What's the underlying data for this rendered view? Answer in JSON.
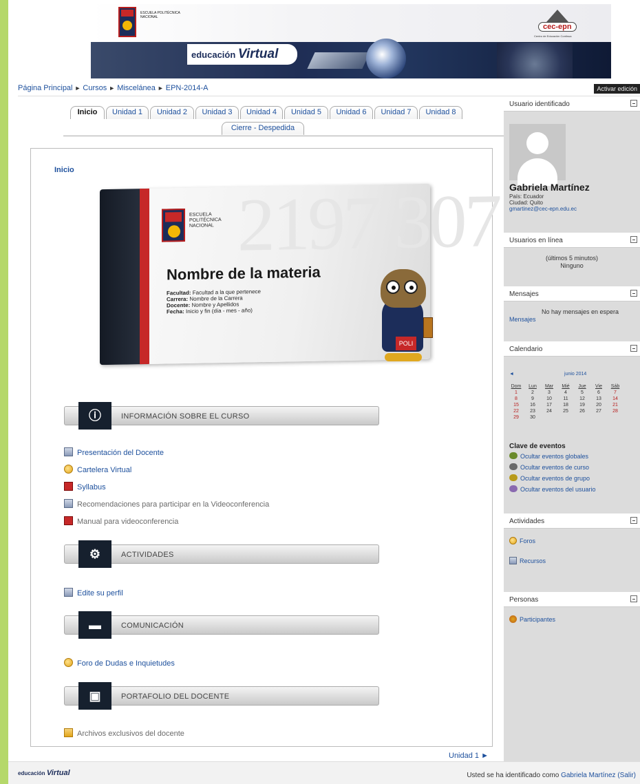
{
  "header": {
    "school_name": "Escuela Politécnica Nacional",
    "cec_logo_text": "cec-epn",
    "cec_subtitle": "Centro de Educación Continua",
    "brand_prefix": "educación",
    "brand_main": "Virtual"
  },
  "breadcrumb": {
    "items": [
      "Página Principal",
      "Cursos",
      "Miscelánea",
      "EPN-2014-A"
    ],
    "separator": "►"
  },
  "edit_button": "Activar edición",
  "tabs": {
    "row1": [
      "Inicio",
      "Unidad 1",
      "Unidad 2",
      "Unidad 3",
      "Unidad 4",
      "Unidad 5",
      "Unidad 6",
      "Unidad 7",
      "Unidad 8"
    ],
    "row2": [
      "Cierre - Despedida"
    ],
    "active": "Inicio"
  },
  "main": {
    "section_title": "Inicio",
    "hero": {
      "numbers_bg": "2197 307",
      "school_name": "Escuela Politécnica Nacional",
      "title": "Nombre de la materia",
      "lines": [
        {
          "label": "Facultad:",
          "value": "Facultad a la que pertenece"
        },
        {
          "label": "Carrera:",
          "value": "Nombre de la Carrera"
        },
        {
          "label": "Docente:",
          "value": "Nombre y Apellidos"
        },
        {
          "label": "Fecha:",
          "value": "Inicio y fin (día - mes - año)"
        }
      ],
      "mascot_label": "POLI"
    },
    "sections": [
      {
        "icon": "info-icon",
        "label": "INFORMACIÓN SOBRE EL CURSO",
        "items": [
          {
            "icon": "document-icon",
            "label": "Presentación del Docente",
            "dim": false
          },
          {
            "icon": "forum-icon",
            "label": "Cartelera Virtual",
            "dim": false
          },
          {
            "icon": "pdf-icon",
            "label": "Syllabus",
            "dim": false
          },
          {
            "icon": "document-icon",
            "label": "Recomendaciones para participar en la Videoconferencia",
            "dim": true
          },
          {
            "icon": "pdf-icon",
            "label": "Manual para videoconferencia",
            "dim": true
          }
        ]
      },
      {
        "icon": "gears-icon",
        "label": "ACTIVIDADES",
        "items": [
          {
            "icon": "document-icon",
            "label": "Edite su perfil",
            "dim": false
          }
        ]
      },
      {
        "icon": "chat-icon",
        "label": "COMUNICACIÓN",
        "items": [
          {
            "icon": "forum-icon",
            "label": "Foro de Dudas e Inquietudes",
            "dim": false
          }
        ]
      },
      {
        "icon": "briefcase-icon",
        "label": "PORTAFOLIO DEL DOCENTE",
        "items": [
          {
            "icon": "folder-icon",
            "label": "Archivos exclusivos del docente",
            "dim": true
          }
        ]
      }
    ],
    "next_link": "Unidad 1 ►"
  },
  "sidebar": {
    "user_block": {
      "title": "Usuario identificado",
      "name": "Gabriela Martínez",
      "country": "País: Ecuador",
      "city": "Ciudad: Quito",
      "email": "gmartinez@cec-epn.edu.ec"
    },
    "online_block": {
      "title": "Usuarios en línea",
      "subtitle": "(últimos 5 minutos)",
      "value": "Ninguno"
    },
    "messages_block": {
      "title": "Mensajes",
      "text": "No hay mensajes en espera",
      "link": "Mensajes"
    },
    "calendar_block": {
      "title": "Calendario",
      "prev": "◄",
      "month": "junio 2014",
      "weekdays": [
        "Dom",
        "Lun",
        "Mar",
        "Mié",
        "Jue",
        "Vie",
        "Sáb"
      ],
      "weeks": [
        [
          "1",
          "2",
          "3",
          "4",
          "5",
          "6",
          "7"
        ],
        [
          "8",
          "9",
          "10",
          "11",
          "12",
          "13",
          "14"
        ],
        [
          "15",
          "16",
          "17",
          "18",
          "19",
          "20",
          "21"
        ],
        [
          "22",
          "23",
          "24",
          "25",
          "26",
          "27",
          "28"
        ],
        [
          "29",
          "30",
          "",
          "",
          "",
          "",
          ""
        ]
      ],
      "key_title": "Clave de eventos",
      "keys": [
        {
          "label": "Ocultar eventos globales",
          "color": "#6a8a2a"
        },
        {
          "label": "Ocultar eventos de curso",
          "color": "#6a6a6a"
        },
        {
          "label": "Ocultar eventos de grupo",
          "color": "#b89a1a"
        },
        {
          "label": "Ocultar eventos del usuario",
          "color": "#8a6ab0"
        }
      ]
    },
    "activities_block": {
      "title": "Actividades",
      "items": [
        "Foros",
        "Recursos"
      ]
    },
    "people_block": {
      "title": "Personas",
      "items": [
        "Participantes"
      ]
    }
  },
  "footer": {
    "logo_prefix": "educación",
    "logo_main": "Virtual",
    "identified_text": "Usted se ha identificado como",
    "user": "Gabriela Martínez",
    "logout": "(Salir)"
  },
  "colors": {
    "accent": "#1c4f9c",
    "page_bg": "#b5d86a",
    "header_dark": "#1c2d5a",
    "brand_red": "#c62828"
  }
}
